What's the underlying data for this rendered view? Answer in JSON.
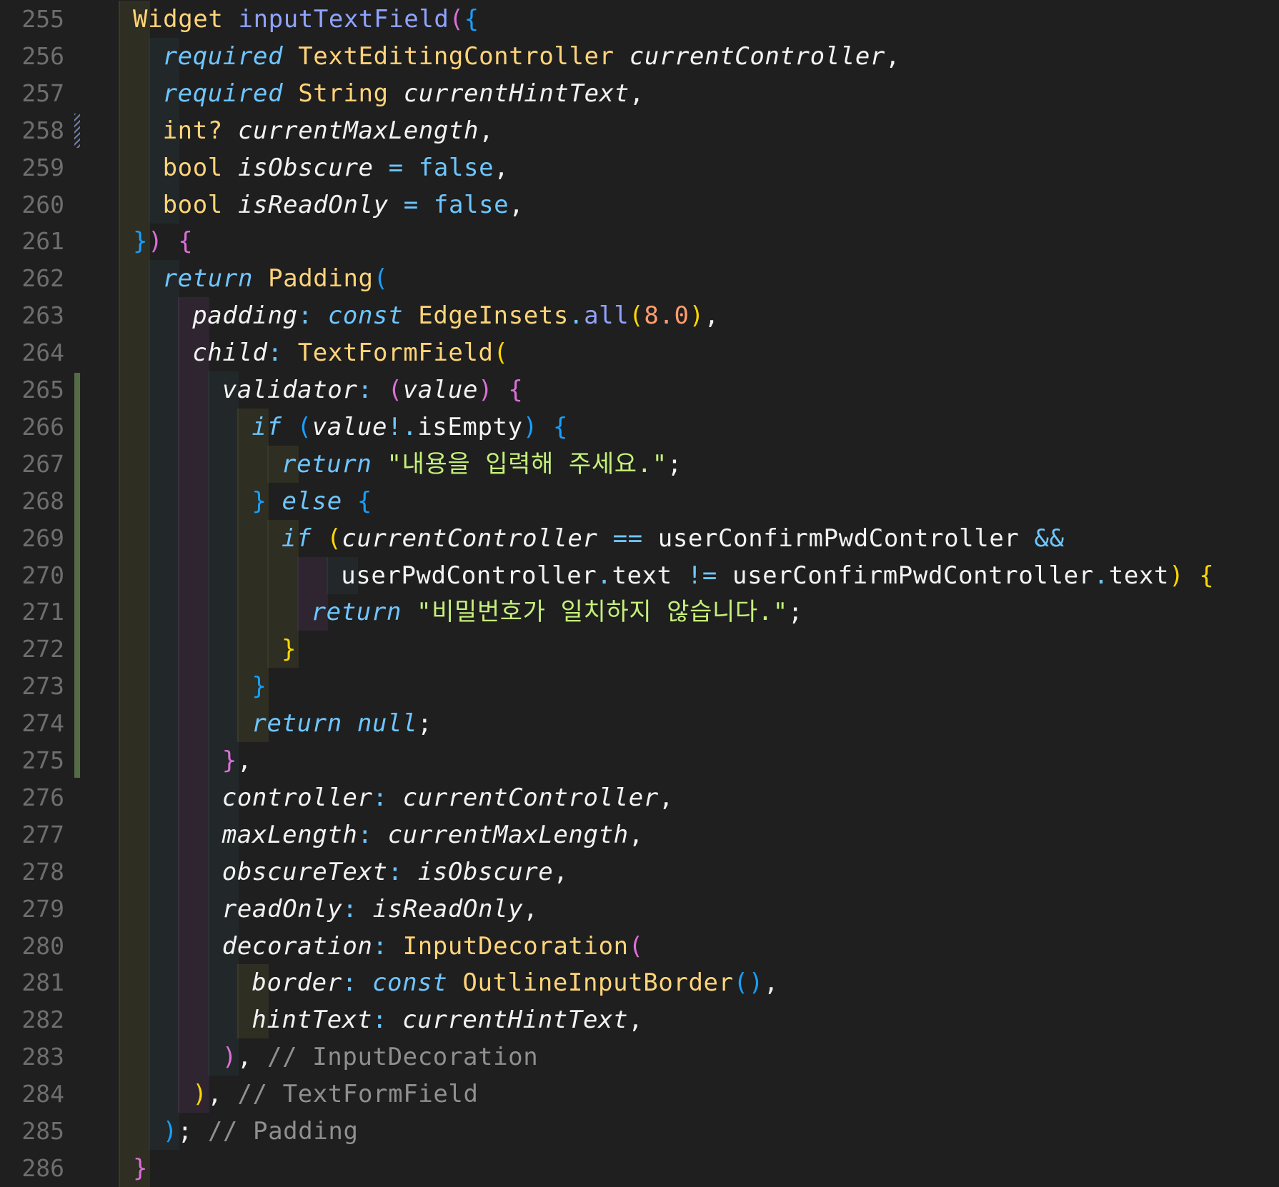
{
  "editor": {
    "gutter_marks": [
      {
        "line": 258,
        "style": "hatched",
        "color": "#6f7fa8"
      },
      {
        "line_start": 265,
        "line_end": 275,
        "style": "solid",
        "color": "#556b45"
      }
    ],
    "lines": [
      {
        "n": "255",
        "guides": [
          0
        ],
        "tokens": [
          {
            "t": "Widget",
            "c": "type"
          },
          {
            "t": " ",
            "c": "plain"
          },
          {
            "t": "inputTextField",
            "c": "fn"
          },
          {
            "t": "(",
            "c": "b2"
          },
          {
            "t": "{",
            "c": "b3"
          }
        ]
      },
      {
        "n": "256",
        "guides": [
          0,
          1
        ],
        "tokens": [
          {
            "t": "required",
            "c": "kw"
          },
          {
            "t": " ",
            "c": "plain"
          },
          {
            "t": "TextEditingController",
            "c": "type"
          },
          {
            "t": " ",
            "c": "plain"
          },
          {
            "t": "currentController",
            "c": "prop"
          },
          {
            "t": ",",
            "c": "plain"
          }
        ]
      },
      {
        "n": "257",
        "guides": [
          0,
          1
        ],
        "tokens": [
          {
            "t": "required",
            "c": "kw"
          },
          {
            "t": " ",
            "c": "plain"
          },
          {
            "t": "String",
            "c": "type"
          },
          {
            "t": " ",
            "c": "plain"
          },
          {
            "t": "currentHintText",
            "c": "prop"
          },
          {
            "t": ",",
            "c": "plain"
          }
        ]
      },
      {
        "n": "258",
        "guides": [
          0,
          1
        ],
        "tokens": [
          {
            "t": "int?",
            "c": "type"
          },
          {
            "t": " ",
            "c": "plain"
          },
          {
            "t": "currentMaxLength",
            "c": "prop"
          },
          {
            "t": ",",
            "c": "plain"
          }
        ]
      },
      {
        "n": "259",
        "guides": [
          0,
          1
        ],
        "tokens": [
          {
            "t": "bool",
            "c": "type"
          },
          {
            "t": " ",
            "c": "plain"
          },
          {
            "t": "isObscure",
            "c": "prop"
          },
          {
            "t": " ",
            "c": "plain"
          },
          {
            "t": "=",
            "c": "op"
          },
          {
            "t": " ",
            "c": "plain"
          },
          {
            "t": "false",
            "c": "lit"
          },
          {
            "t": ",",
            "c": "plain"
          }
        ]
      },
      {
        "n": "260",
        "guides": [
          0,
          1
        ],
        "tokens": [
          {
            "t": "bool",
            "c": "type"
          },
          {
            "t": " ",
            "c": "plain"
          },
          {
            "t": "isReadOnly",
            "c": "prop"
          },
          {
            "t": " ",
            "c": "plain"
          },
          {
            "t": "=",
            "c": "op"
          },
          {
            "t": " ",
            "c": "plain"
          },
          {
            "t": "false",
            "c": "lit"
          },
          {
            "t": ",",
            "c": "plain"
          }
        ]
      },
      {
        "n": "261",
        "guides": [
          0
        ],
        "tokens": [
          {
            "t": "}",
            "c": "b3"
          },
          {
            "t": ")",
            "c": "b2"
          },
          {
            "t": " ",
            "c": "plain"
          },
          {
            "t": "{",
            "c": "b2"
          }
        ]
      },
      {
        "n": "262",
        "guides": [
          0,
          1
        ],
        "tokens": [
          {
            "t": "return",
            "c": "kw"
          },
          {
            "t": " ",
            "c": "plain"
          },
          {
            "t": "Padding",
            "c": "type"
          },
          {
            "t": "(",
            "c": "b3"
          }
        ]
      },
      {
        "n": "263",
        "guides": [
          0,
          1,
          2
        ],
        "tokens": [
          {
            "t": "padding",
            "c": "prop"
          },
          {
            "t": ":",
            "c": "op"
          },
          {
            "t": " ",
            "c": "plain"
          },
          {
            "t": "const",
            "c": "kw"
          },
          {
            "t": " ",
            "c": "plain"
          },
          {
            "t": "EdgeInsets",
            "c": "type"
          },
          {
            "t": ".",
            "c": "op"
          },
          {
            "t": "all",
            "c": "fn"
          },
          {
            "t": "(",
            "c": "b1"
          },
          {
            "t": "8.0",
            "c": "num"
          },
          {
            "t": ")",
            "c": "b1"
          },
          {
            "t": ",",
            "c": "plain"
          }
        ]
      },
      {
        "n": "264",
        "guides": [
          0,
          1,
          2
        ],
        "tokens": [
          {
            "t": "child",
            "c": "prop"
          },
          {
            "t": ":",
            "c": "op"
          },
          {
            "t": " ",
            "c": "plain"
          },
          {
            "t": "TextFormField",
            "c": "type"
          },
          {
            "t": "(",
            "c": "b1"
          }
        ]
      },
      {
        "n": "265",
        "guides": [
          0,
          1,
          2,
          3
        ],
        "tokens": [
          {
            "t": "validator",
            "c": "prop"
          },
          {
            "t": ":",
            "c": "op"
          },
          {
            "t": " ",
            "c": "plain"
          },
          {
            "t": "(",
            "c": "b2"
          },
          {
            "t": "value",
            "c": "prop"
          },
          {
            "t": ")",
            "c": "b2"
          },
          {
            "t": " ",
            "c": "plain"
          },
          {
            "t": "{",
            "c": "b2"
          }
        ]
      },
      {
        "n": "266",
        "guides": [
          0,
          1,
          2,
          3,
          4
        ],
        "tokens": [
          {
            "t": "if",
            "c": "kw"
          },
          {
            "t": " ",
            "c": "plain"
          },
          {
            "t": "(",
            "c": "b3"
          },
          {
            "t": "value",
            "c": "prop"
          },
          {
            "t": "!.",
            "c": "op"
          },
          {
            "t": "isEmpty",
            "c": "plain"
          },
          {
            "t": ")",
            "c": "b3"
          },
          {
            "t": " ",
            "c": "plain"
          },
          {
            "t": "{",
            "c": "b3"
          }
        ]
      },
      {
        "n": "267",
        "guides": [
          0,
          1,
          2,
          3,
          4,
          5
        ],
        "tokens": [
          {
            "t": "return",
            "c": "kw"
          },
          {
            "t": " ",
            "c": "plain"
          },
          {
            "t": "\"내용을 입력해 주세요.\"",
            "c": "str"
          },
          {
            "t": ";",
            "c": "plain"
          }
        ]
      },
      {
        "n": "268",
        "guides": [
          0,
          1,
          2,
          3,
          4
        ],
        "tokens": [
          {
            "t": "}",
            "c": "b3"
          },
          {
            "t": " ",
            "c": "plain"
          },
          {
            "t": "else",
            "c": "kw"
          },
          {
            "t": " ",
            "c": "plain"
          },
          {
            "t": "{",
            "c": "b3"
          }
        ]
      },
      {
        "n": "269",
        "guides": [
          0,
          1,
          2,
          3,
          4,
          5
        ],
        "tokens": [
          {
            "t": "if",
            "c": "kw"
          },
          {
            "t": " ",
            "c": "plain"
          },
          {
            "t": "(",
            "c": "b1"
          },
          {
            "t": "currentController",
            "c": "prop"
          },
          {
            "t": " ",
            "c": "plain"
          },
          {
            "t": "==",
            "c": "op"
          },
          {
            "t": " ",
            "c": "plain"
          },
          {
            "t": "userConfirmPwdController",
            "c": "plain"
          },
          {
            "t": " ",
            "c": "plain"
          },
          {
            "t": "&&",
            "c": "op"
          }
        ]
      },
      {
        "n": "270",
        "guides": [
          0,
          1,
          2,
          3,
          4,
          5,
          6,
          7
        ],
        "tokens": [
          {
            "t": "userPwdController",
            "c": "plain"
          },
          {
            "t": ".",
            "c": "op"
          },
          {
            "t": "text",
            "c": "plain"
          },
          {
            "t": " ",
            "c": "plain"
          },
          {
            "t": "!=",
            "c": "op"
          },
          {
            "t": " ",
            "c": "plain"
          },
          {
            "t": "userConfirmPwdController",
            "c": "plain"
          },
          {
            "t": ".",
            "c": "op"
          },
          {
            "t": "text",
            "c": "plain"
          },
          {
            "t": ")",
            "c": "b1"
          },
          {
            "t": " ",
            "c": "plain"
          },
          {
            "t": "{",
            "c": "b1"
          }
        ]
      },
      {
        "n": "271",
        "guides": [
          0,
          1,
          2,
          3,
          4,
          5,
          6
        ],
        "tokens": [
          {
            "t": "return",
            "c": "kw"
          },
          {
            "t": " ",
            "c": "plain"
          },
          {
            "t": "\"비밀번호가 일치하지 않습니다.\"",
            "c": "str"
          },
          {
            "t": ";",
            "c": "plain"
          }
        ]
      },
      {
        "n": "272",
        "guides": [
          0,
          1,
          2,
          3,
          4,
          5
        ],
        "tokens": [
          {
            "t": "}",
            "c": "b1"
          }
        ]
      },
      {
        "n": "273",
        "guides": [
          0,
          1,
          2,
          3,
          4
        ],
        "tokens": [
          {
            "t": "}",
            "c": "b3"
          }
        ]
      },
      {
        "n": "274",
        "guides": [
          0,
          1,
          2,
          3,
          4
        ],
        "tokens": [
          {
            "t": "return",
            "c": "kw"
          },
          {
            "t": " ",
            "c": "plain"
          },
          {
            "t": "null",
            "c": "kw"
          },
          {
            "t": ";",
            "c": "plain"
          }
        ]
      },
      {
        "n": "275",
        "guides": [
          0,
          1,
          2,
          3
        ],
        "tokens": [
          {
            "t": "}",
            "c": "b2"
          },
          {
            "t": ",",
            "c": "plain"
          }
        ]
      },
      {
        "n": "276",
        "guides": [
          0,
          1,
          2,
          3
        ],
        "tokens": [
          {
            "t": "controller",
            "c": "prop"
          },
          {
            "t": ":",
            "c": "op"
          },
          {
            "t": " ",
            "c": "plain"
          },
          {
            "t": "currentController",
            "c": "prop"
          },
          {
            "t": ",",
            "c": "plain"
          }
        ]
      },
      {
        "n": "277",
        "guides": [
          0,
          1,
          2,
          3
        ],
        "tokens": [
          {
            "t": "maxLength",
            "c": "prop"
          },
          {
            "t": ":",
            "c": "op"
          },
          {
            "t": " ",
            "c": "plain"
          },
          {
            "t": "currentMaxLength",
            "c": "prop"
          },
          {
            "t": ",",
            "c": "plain"
          }
        ]
      },
      {
        "n": "278",
        "guides": [
          0,
          1,
          2,
          3
        ],
        "tokens": [
          {
            "t": "obscureText",
            "c": "prop"
          },
          {
            "t": ":",
            "c": "op"
          },
          {
            "t": " ",
            "c": "plain"
          },
          {
            "t": "isObscure",
            "c": "prop"
          },
          {
            "t": ",",
            "c": "plain"
          }
        ]
      },
      {
        "n": "279",
        "guides": [
          0,
          1,
          2,
          3
        ],
        "tokens": [
          {
            "t": "readOnly",
            "c": "prop"
          },
          {
            "t": ":",
            "c": "op"
          },
          {
            "t": " ",
            "c": "plain"
          },
          {
            "t": "isReadOnly",
            "c": "prop"
          },
          {
            "t": ",",
            "c": "plain"
          }
        ]
      },
      {
        "n": "280",
        "guides": [
          0,
          1,
          2,
          3
        ],
        "tokens": [
          {
            "t": "decoration",
            "c": "prop"
          },
          {
            "t": ":",
            "c": "op"
          },
          {
            "t": " ",
            "c": "plain"
          },
          {
            "t": "InputDecoration",
            "c": "type"
          },
          {
            "t": "(",
            "c": "b2"
          }
        ]
      },
      {
        "n": "281",
        "guides": [
          0,
          1,
          2,
          3,
          4
        ],
        "tokens": [
          {
            "t": "border",
            "c": "prop"
          },
          {
            "t": ":",
            "c": "op"
          },
          {
            "t": " ",
            "c": "plain"
          },
          {
            "t": "const",
            "c": "kw"
          },
          {
            "t": " ",
            "c": "plain"
          },
          {
            "t": "OutlineInputBorder",
            "c": "type"
          },
          {
            "t": "()",
            "c": "b3"
          },
          {
            "t": ",",
            "c": "plain"
          }
        ]
      },
      {
        "n": "282",
        "guides": [
          0,
          1,
          2,
          3,
          4
        ],
        "tokens": [
          {
            "t": "hintText",
            "c": "prop"
          },
          {
            "t": ":",
            "c": "op"
          },
          {
            "t": " ",
            "c": "plain"
          },
          {
            "t": "currentHintText",
            "c": "prop"
          },
          {
            "t": ",",
            "c": "plain"
          }
        ]
      },
      {
        "n": "283",
        "guides": [
          0,
          1,
          2,
          3
        ],
        "tokens": [
          {
            "t": ")",
            "c": "b2"
          },
          {
            "t": ",",
            "c": "plain"
          },
          {
            "t": " ",
            "c": "plain"
          },
          {
            "t": "// InputDecoration",
            "c": "com"
          }
        ]
      },
      {
        "n": "284",
        "guides": [
          0,
          1,
          2
        ],
        "tokens": [
          {
            "t": ")",
            "c": "b1"
          },
          {
            "t": ",",
            "c": "plain"
          },
          {
            "t": " ",
            "c": "plain"
          },
          {
            "t": "// TextFormField",
            "c": "com"
          }
        ]
      },
      {
        "n": "285",
        "guides": [
          0,
          1
        ],
        "tokens": [
          {
            "t": ")",
            "c": "b3"
          },
          {
            "t": ";",
            "c": "plain"
          },
          {
            "t": " ",
            "c": "plain"
          },
          {
            "t": "// Padding",
            "c": "com"
          }
        ]
      },
      {
        "n": "286",
        "guides": [
          0
        ],
        "tokens": [
          {
            "t": "}",
            "c": "b2"
          }
        ]
      }
    ]
  }
}
